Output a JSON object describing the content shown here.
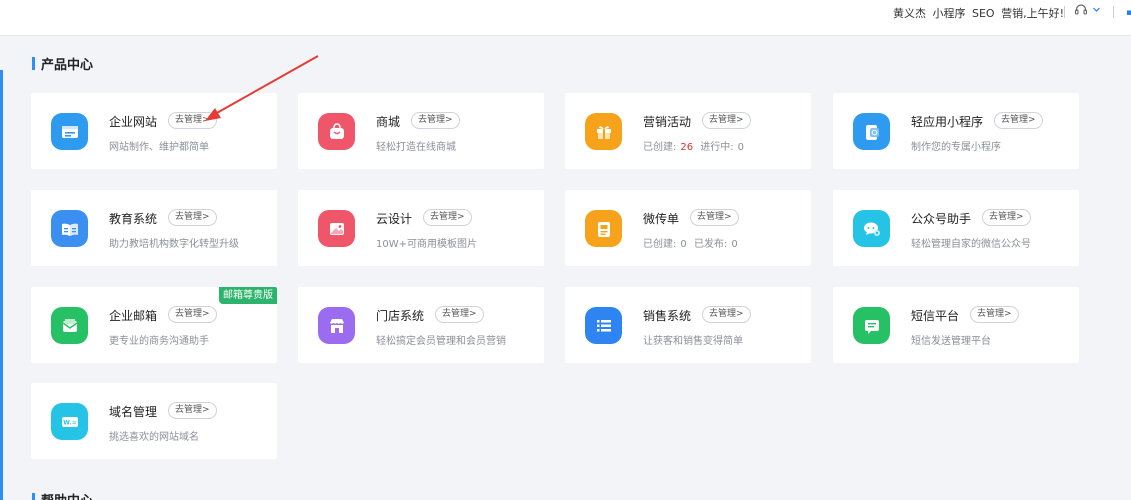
{
  "header": {
    "user_name": "黄义杰",
    "link_miniapp": "小程序",
    "link_seo": "SEO",
    "greeting": "营销,上午好!"
  },
  "section": {
    "title": "产品中心"
  },
  "help_section": {
    "title": "帮助中心"
  },
  "manage_label": "去管理>",
  "cards": [
    {
      "name": "企业网站",
      "desc": "网站制作、维护都简单",
      "icon": "website-icon",
      "color": "#2e9bf0"
    },
    {
      "name": "商城",
      "desc": "轻松打造在线商城",
      "icon": "shop-bag-icon",
      "color": "#f0566a"
    },
    {
      "name": "营销活动",
      "desc_prefix": "已创建:",
      "count_created": "26",
      "desc_mid": "进行中:",
      "count_running": "0",
      "icon": "gift-icon",
      "color": "#f6a21a"
    },
    {
      "name": "轻应用小程序",
      "desc": "制作您的专属小程序",
      "icon": "mini-program-icon",
      "color": "#2e9bf0"
    },
    {
      "name": "教育系统",
      "desc": "助力教培机构数字化转型升级",
      "icon": "book-icon",
      "color": "#3b8ff0"
    },
    {
      "name": "云设计",
      "desc": "10W+可商用模板图片",
      "icon": "image-icon",
      "color": "#f0566a"
    },
    {
      "name": "微传单",
      "desc_prefix": "已创建:",
      "count_created": "0",
      "desc_mid": "已发布:",
      "count_published": "0",
      "icon": "flyer-icon",
      "color": "#f6a21a"
    },
    {
      "name": "公众号助手",
      "desc": "轻松管理自家的微信公众号",
      "icon": "wechat-icon",
      "color": "#25c4e6"
    },
    {
      "name": "企业邮箱",
      "desc": "更专业的商务沟通助手",
      "icon": "mail-icon",
      "color": "#27c165",
      "badge": "邮箱尊贵版"
    },
    {
      "name": "门店系统",
      "desc": "轻松搞定会员管理和会员营销",
      "icon": "store-icon",
      "color": "#9b6cf0"
    },
    {
      "name": "销售系统",
      "desc": "让获客和销售变得简单",
      "icon": "list-icon",
      "color": "#2e84f0"
    },
    {
      "name": "短信平台",
      "desc": "短信发送管理平台",
      "icon": "sms-icon",
      "color": "#27c165"
    },
    {
      "name": "域名管理",
      "desc": "挑选喜欢的网站域名",
      "icon": "domain-icon",
      "color": "#25c4e6"
    }
  ]
}
